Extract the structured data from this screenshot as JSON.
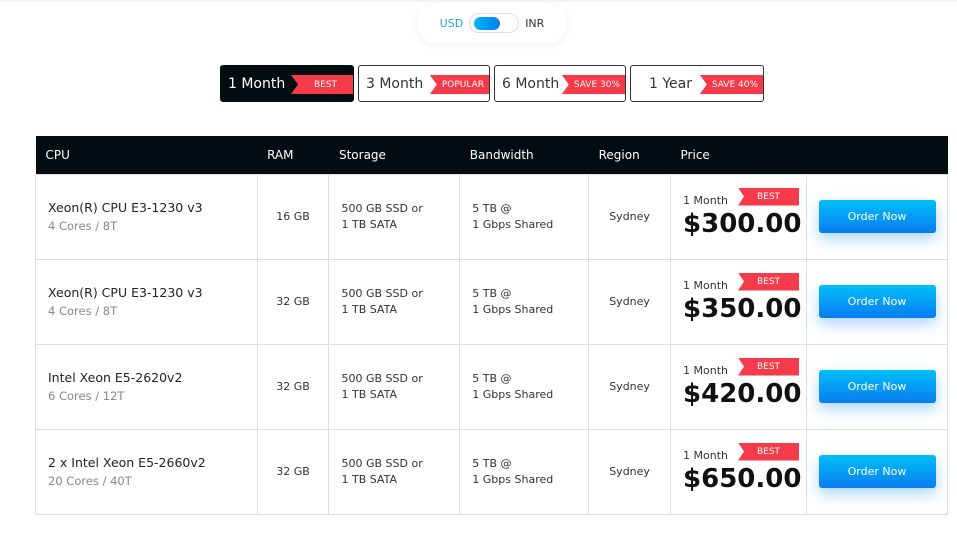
{
  "currency": {
    "left": "USD",
    "right": "INR",
    "selected": "USD"
  },
  "tabs": [
    {
      "label": "1 Month",
      "badge": "BEST",
      "active": true
    },
    {
      "label": "3 Month",
      "badge": "POPULAR"
    },
    {
      "label": "6 Month",
      "badge": "SAVE 30%"
    },
    {
      "label": "1 Year",
      "badge": "SAVE 40%"
    }
  ],
  "table": {
    "headers": [
      "CPU",
      "RAM",
      "Storage",
      "Bandwidth",
      "Region",
      "Price",
      ""
    ],
    "rows": [
      {
        "cpu": "Xeon(R) CPU E3-1230 v3",
        "cores": "4 Cores / 8T",
        "ram": "16 GB",
        "storage1": "500 GB SSD or",
        "storage2": "1 TB SATA",
        "bw1": "5 TB @",
        "bw2": "1 Gbps Shared",
        "region": "Sydney",
        "period": "1 Month",
        "badge": "BEST",
        "price": "$300.00",
        "order": "Order Now"
      },
      {
        "cpu": "Xeon(R) CPU E3-1230 v3",
        "cores": "4 Cores / 8T",
        "ram": "32 GB",
        "storage1": "500 GB SSD or",
        "storage2": "1 TB SATA",
        "bw1": "5 TB @",
        "bw2": "1 Gbps Shared",
        "region": "Sydney",
        "period": "1 Month",
        "badge": "BEST",
        "price": "$350.00",
        "order": "Order Now"
      },
      {
        "cpu": "Intel Xeon E5-2620v2",
        "cores": "6 Cores / 12T",
        "ram": "32 GB",
        "storage1": "500 GB SSD or",
        "storage2": "1 TB SATA",
        "bw1": "5 TB @",
        "bw2": "1 Gbps Shared",
        "region": "Sydney",
        "period": "1 Month",
        "badge": "BEST",
        "price": "$420.00",
        "order": "Order Now"
      },
      {
        "cpu": "2 x Intel Xeon E5-2660v2",
        "cores": "20 Cores / 40T",
        "ram": "32 GB",
        "storage1": "500 GB SSD or",
        "storage2": "1 TB SATA",
        "bw1": "5 TB @",
        "bw2": "1 Gbps Shared",
        "region": "Sydney",
        "period": "1 Month",
        "badge": "BEST",
        "price": "$650.00",
        "order": "Order Now"
      }
    ]
  },
  "colors": {
    "accent": "#0a9cf2",
    "badge": "#f53b49",
    "header": "#030c11"
  }
}
